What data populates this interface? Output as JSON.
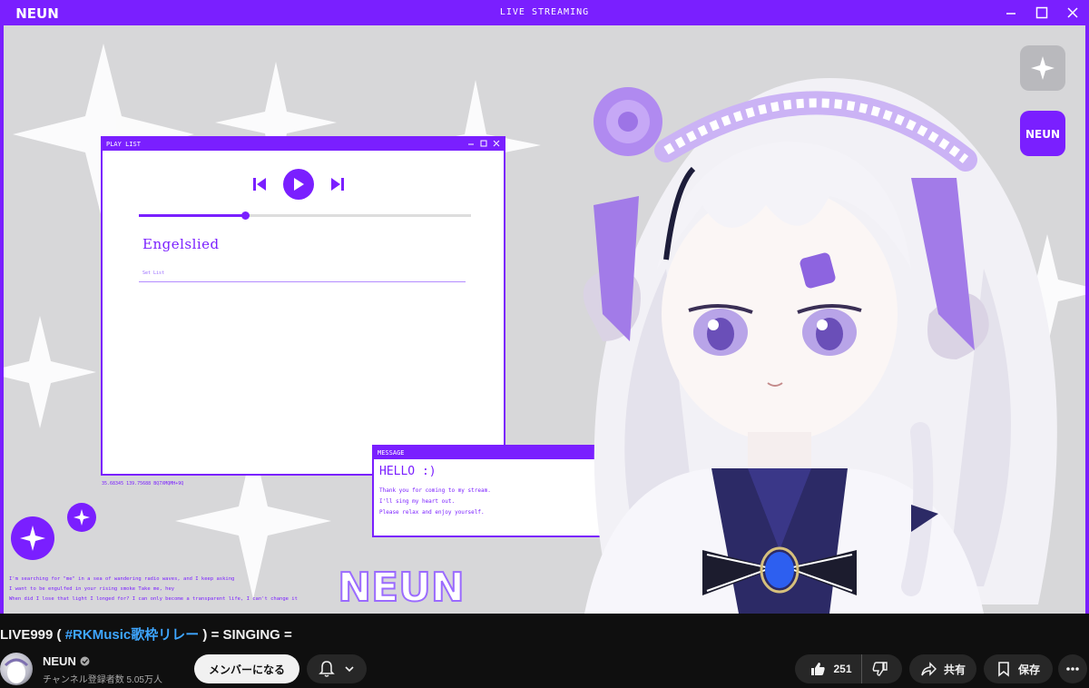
{
  "stream": {
    "window_title": "LIVE STREAMING",
    "logo_text": "NEUN",
    "playlist": {
      "title": "PLAY LIST",
      "song": "Engelslied",
      "setlist_label": "Set List",
      "progress": 0.32
    },
    "coords_text": "35.68345 139.75688 BQ7XMQMH+9Q",
    "message": {
      "title": "MESSAGE",
      "hello": "HELLO :)",
      "lines": [
        "Thank you for coming to my stream.",
        "I'll sing my heart out.",
        "Please relax and enjoy yourself."
      ]
    },
    "lyrics": [
      "I'm searching for \"me\" in a sea of wandering radio waves, and I keep asking",
      "I want to be engulfed in your rising smoke Take me, hey",
      "When did I lose that light I longed for? I can only become a transparent life, I can't change it"
    ],
    "side_logo_text": "NEUN"
  },
  "video": {
    "title_prefix": "LIVE999 ( ",
    "title_hashtag": "#RKMusic歌枠リレー",
    "title_suffix": " ) = SINGING ="
  },
  "channel": {
    "name": "NEUN",
    "subscribers": "チャンネル登録者数 5.05万人"
  },
  "actions": {
    "join": "メンバーになる",
    "likes": "251",
    "share": "共有",
    "save": "保存"
  },
  "colors": {
    "accent": "#7a1fff",
    "canvas": "#d7d7d9",
    "link": "#3ea6ff",
    "yt_bg": "#0f0f0f",
    "pill_bg": "#272727"
  }
}
